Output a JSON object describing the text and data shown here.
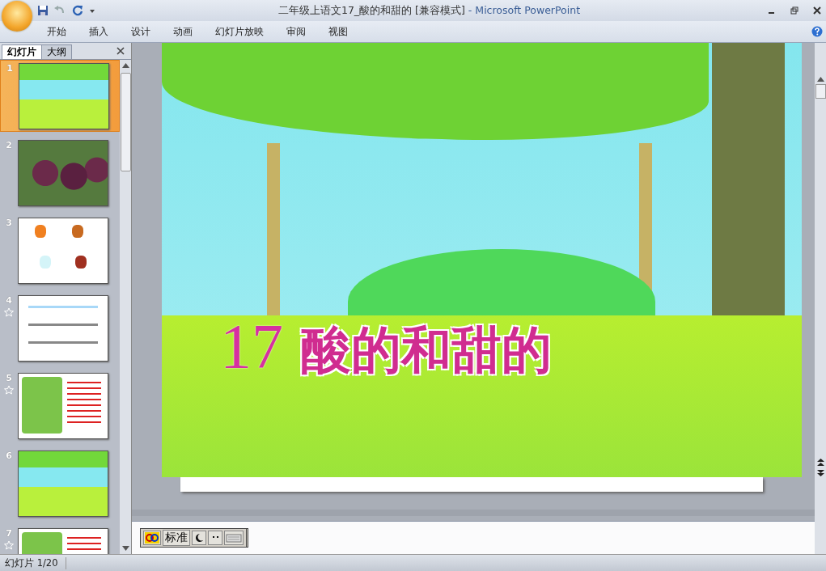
{
  "window": {
    "title": "二年级上语文17_酸的和甜的 [兼容模式]",
    "app_name": "- Microsoft PowerPoint"
  },
  "ribbon_tabs": [
    {
      "label": "开始"
    },
    {
      "label": "插入"
    },
    {
      "label": "设计"
    },
    {
      "label": "动画"
    },
    {
      "label": "幻灯片放映"
    },
    {
      "label": "审阅"
    },
    {
      "label": "视图"
    }
  ],
  "panel_tabs": [
    {
      "label": "幻灯片",
      "selected": true
    },
    {
      "label": "大纲",
      "selected": false
    }
  ],
  "slides": [
    {
      "number": "1",
      "selected": true,
      "animated": false,
      "kind": "scene"
    },
    {
      "number": "2",
      "selected": false,
      "animated": false,
      "kind": "photo"
    },
    {
      "number": "3",
      "selected": false,
      "animated": false,
      "kind": "animals"
    },
    {
      "number": "4",
      "selected": false,
      "animated": true,
      "kind": "text"
    },
    {
      "number": "5",
      "selected": false,
      "animated": true,
      "kind": "story"
    },
    {
      "number": "6",
      "selected": false,
      "animated": false,
      "kind": "scene"
    },
    {
      "number": "7",
      "selected": false,
      "animated": true,
      "kind": "story"
    }
  ],
  "slide": {
    "title_number": "17",
    "title": "酸的和甜的"
  },
  "ime_toolbar": {
    "mode": "标准"
  },
  "status_bar": {
    "slide_indicator": "幻灯片 1/20"
  }
}
